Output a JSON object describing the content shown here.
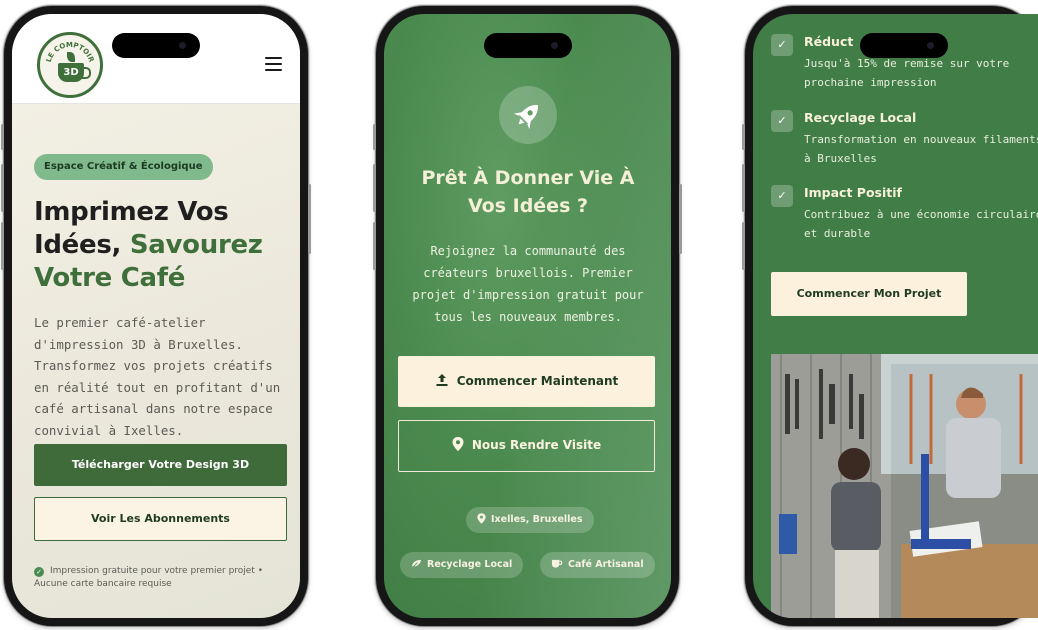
{
  "phone1": {
    "logo": {
      "ring_text": "LE COMPTOIR",
      "cup_text": "3D"
    },
    "menu_icon": "hamburger-icon",
    "badge": "Espace Créatif & Écologique",
    "title_line1": "Imprimez Vos",
    "title_line2_plain": "Idées, ",
    "title_line2_accent": "Savourez",
    "title_line3_accent": "Votre Café",
    "description": "Le premier café-atelier d'impression 3D à Bruxelles. Transformez vos projets créatifs en réalité tout en profitant d'un café artisanal dans notre espace convivial à Ixelles.",
    "primary_button": "Télécharger Votre Design 3D",
    "secondary_button": "Voir Les Abonnements",
    "note": "Impression gratuite pour votre premier projet • Aucune carte bancaire requise"
  },
  "phone2": {
    "hero_icon": "rocket-icon",
    "title": "Prêt À Donner Vie À Vos Idées ?",
    "description": "Rejoignez la communauté des créateurs bruxellois. Premier projet d'impression gratuit pour tous les nouveaux membres.",
    "primary_button": "Commencer Maintenant",
    "primary_icon": "upload-icon",
    "secondary_button": "Nous Rendre Visite",
    "secondary_icon": "map-pin-icon",
    "pills": [
      {
        "label": "Ixelles, Bruxelles",
        "icon": "map-pin-icon"
      },
      {
        "label": "Recyclage Local",
        "icon": "recycle-icon"
      },
      {
        "label": "Café Artisanal",
        "icon": "coffee-cup-icon"
      }
    ]
  },
  "phone3": {
    "features": [
      {
        "title": "Réduct",
        "desc": "Jusqu'à 15% de remise sur votre prochaine impression"
      },
      {
        "title": "Recyclage Local",
        "desc": "Transformation en nouveaux filaments à Bruxelles"
      },
      {
        "title": "Impact Positif",
        "desc": "Contribuez à une économie circulaire et durable"
      }
    ],
    "button": "Commencer Mon Projet",
    "photo": "workshop-photo"
  },
  "colors": {
    "brand_green": "#3f6b3a",
    "accent_green": "#7fb98c",
    "cream": "#fbf1dc",
    "panel_green": "#417d46"
  }
}
